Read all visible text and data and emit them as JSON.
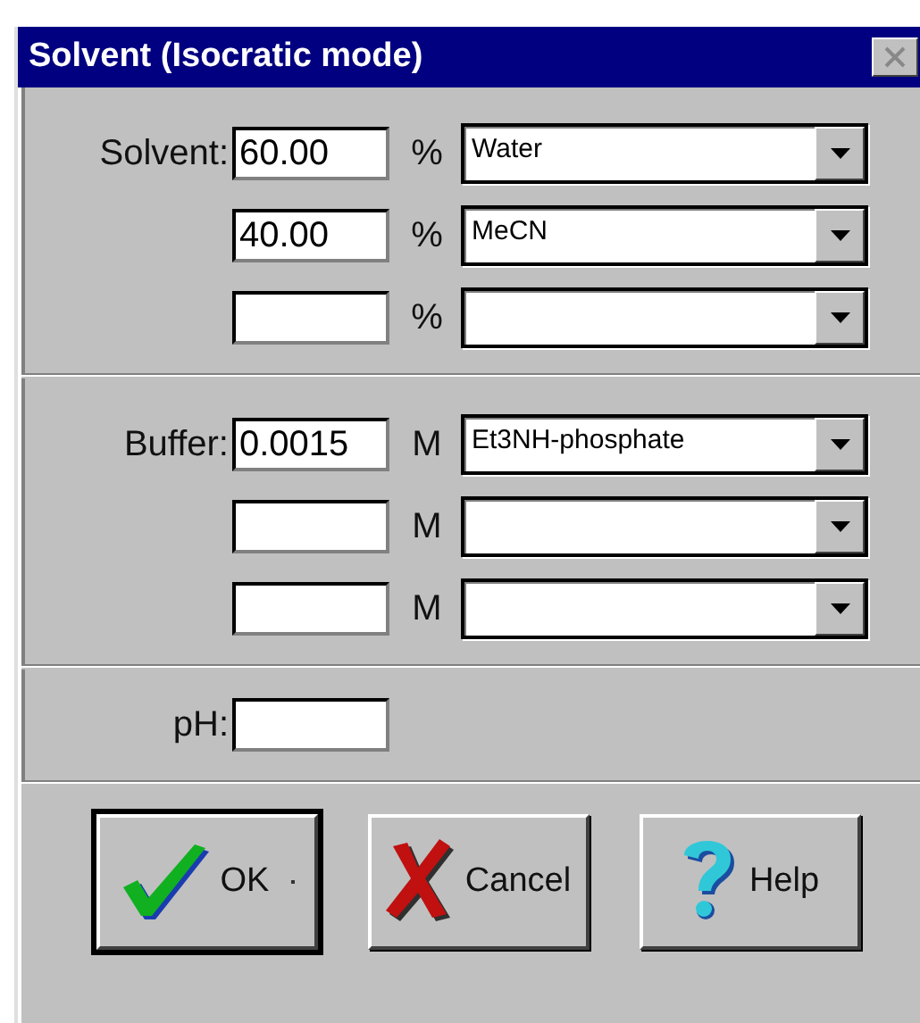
{
  "window": {
    "title": "Solvent (Isocratic mode)"
  },
  "solvent": {
    "label": "Solvent:",
    "rows": [
      {
        "amount": "60.00",
        "unit": "%",
        "component": "Water"
      },
      {
        "amount": "40.00",
        "unit": "%",
        "component": "MeCN"
      },
      {
        "unit": "%"
      }
    ]
  },
  "buffer": {
    "label": "Buffer:",
    "rows": [
      {
        "amount": "0.0015",
        "unit": "M",
        "component": "Et3NH-phosphate"
      },
      {
        "unit": "M"
      },
      {
        "unit": "M"
      }
    ]
  },
  "ph": {
    "label": "pH:"
  },
  "buttons": [
    {
      "kind": "ok",
      "label": "OK",
      "default": true
    },
    {
      "kind": "cancel",
      "label": "Cancel",
      "default": false
    },
    {
      "kind": "help",
      "label": "Help",
      "default": false
    }
  ]
}
